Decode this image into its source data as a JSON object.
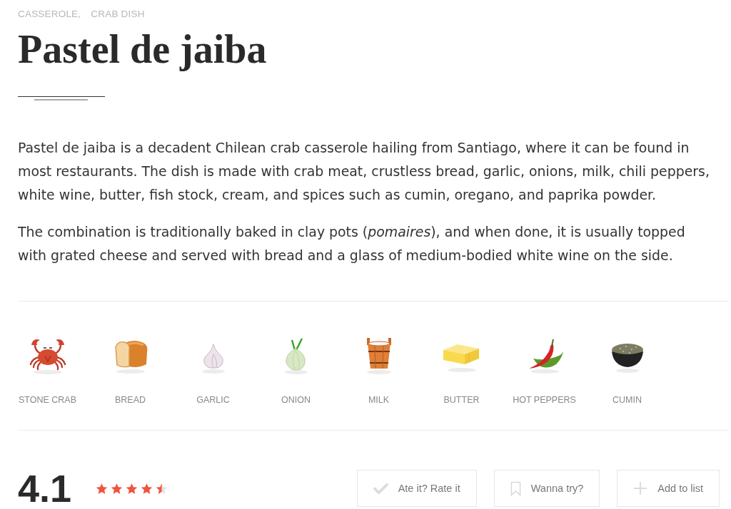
{
  "categories": [
    "CASSEROLE,",
    "CRAB DISH"
  ],
  "title": "Pastel de jaiba",
  "description": [
    "Pastel de jaiba is a decadent Chilean crab casserole hailing from Santiago, where it can be found in most restaurants. The dish is made with crab meat, crustless bread, garlic, onions, milk, chili peppers, white wine, butter, fish stock, cream, and spices such as cumin, oregano, and paprika powder.",
    "The combination is traditionally baked in clay pots (*pomaires*), and when done, it is usually topped with grated cheese and served with bread and a glass of medium-bodied white wine on the side."
  ],
  "ingredients": [
    "STONE CRAB",
    "BREAD",
    "GARLIC",
    "ONION",
    "MILK",
    "BUTTER",
    "HOT PEPPERS",
    "CUMIN"
  ],
  "rating": {
    "score": "4.1",
    "stars": 4.5
  },
  "actions": [
    "Ate it? Rate it",
    "Wanna try?",
    "Add to list"
  ]
}
